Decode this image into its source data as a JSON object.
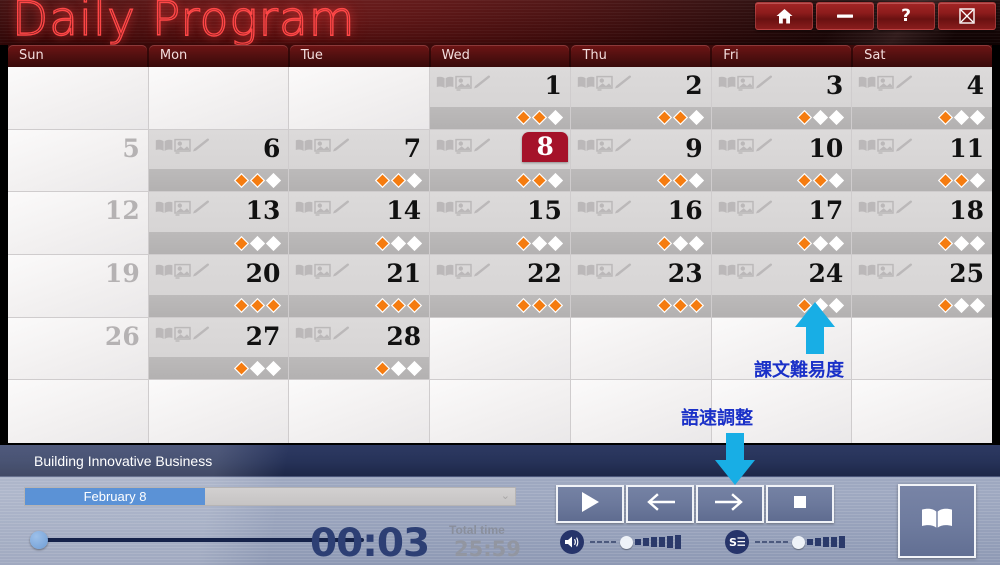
{
  "window": {
    "title": "Daily Program",
    "buttons": [
      {
        "name": "home-button",
        "icon": "home-icon",
        "label": ""
      },
      {
        "name": "minimize-button",
        "icon": "minimize-icon",
        "label": ""
      },
      {
        "name": "help-button",
        "icon": "question-icon",
        "label": "?"
      },
      {
        "name": "close-button",
        "icon": "close-boxed-icon",
        "label": ""
      }
    ]
  },
  "calendar": {
    "weekdays": [
      "Sun",
      "Mon",
      "Tue",
      "Wed",
      "Thu",
      "Fri",
      "Sat"
    ],
    "selected_day": 8,
    "cell_icons": [
      "book-icon",
      "media-card-icon",
      "pencil-icon"
    ],
    "difficulty_max": 3,
    "weeks": [
      [
        {
          "day": "",
          "state": "blank"
        },
        {
          "day": "",
          "state": "blank"
        },
        {
          "day": "",
          "state": "blank"
        },
        {
          "day": "1",
          "state": "lesson",
          "difficulty": 2
        },
        {
          "day": "2",
          "state": "lesson",
          "difficulty": 2
        },
        {
          "day": "3",
          "state": "lesson",
          "difficulty": 1
        },
        {
          "day": "4",
          "state": "lesson",
          "difficulty": 1
        }
      ],
      [
        {
          "day": "5",
          "state": "empty"
        },
        {
          "day": "6",
          "state": "lesson",
          "difficulty": 2
        },
        {
          "day": "7",
          "state": "lesson",
          "difficulty": 2
        },
        {
          "day": "8",
          "state": "lesson",
          "difficulty": 2,
          "selected": true
        },
        {
          "day": "9",
          "state": "lesson",
          "difficulty": 2
        },
        {
          "day": "10",
          "state": "lesson",
          "difficulty": 2
        },
        {
          "day": "11",
          "state": "lesson",
          "difficulty": 2
        }
      ],
      [
        {
          "day": "12",
          "state": "empty"
        },
        {
          "day": "13",
          "state": "lesson",
          "difficulty": 1
        },
        {
          "day": "14",
          "state": "lesson",
          "difficulty": 1
        },
        {
          "day": "15",
          "state": "lesson",
          "difficulty": 1
        },
        {
          "day": "16",
          "state": "lesson",
          "difficulty": 1
        },
        {
          "day": "17",
          "state": "lesson",
          "difficulty": 1
        },
        {
          "day": "18",
          "state": "lesson",
          "difficulty": 1
        }
      ],
      [
        {
          "day": "19",
          "state": "empty"
        },
        {
          "day": "20",
          "state": "lesson",
          "difficulty": 3
        },
        {
          "day": "21",
          "state": "lesson",
          "difficulty": 3
        },
        {
          "day": "22",
          "state": "lesson",
          "difficulty": 3
        },
        {
          "day": "23",
          "state": "lesson",
          "difficulty": 3
        },
        {
          "day": "24",
          "state": "lesson",
          "difficulty": 1
        },
        {
          "day": "25",
          "state": "lesson",
          "difficulty": 1
        }
      ],
      [
        {
          "day": "26",
          "state": "empty"
        },
        {
          "day": "27",
          "state": "lesson",
          "difficulty": 1
        },
        {
          "day": "28",
          "state": "lesson",
          "difficulty": 1
        },
        {
          "day": "",
          "state": "blank"
        },
        {
          "day": "",
          "state": "blank"
        },
        {
          "day": "",
          "state": "blank"
        },
        {
          "day": "",
          "state": "blank"
        }
      ],
      [
        {
          "day": "",
          "state": "blank"
        },
        {
          "day": "",
          "state": "blank"
        },
        {
          "day": "",
          "state": "blank"
        },
        {
          "day": "",
          "state": "blank"
        },
        {
          "day": "",
          "state": "blank"
        },
        {
          "day": "",
          "state": "blank"
        },
        {
          "day": "",
          "state": "blank"
        }
      ]
    ]
  },
  "player": {
    "lesson_title": "Building Innovative Business",
    "selected_lesson": "February 8",
    "current_time": "00:03",
    "total_time_label": "Total time",
    "total_time": "25:59",
    "progress_percent": 0,
    "controls": [
      {
        "name": "play-button",
        "icon": "play-icon"
      },
      {
        "name": "previous-button",
        "icon": "arrow-left-icon"
      },
      {
        "name": "next-button",
        "icon": "arrow-right-icon"
      },
      {
        "name": "stop-button",
        "icon": "stop-icon"
      }
    ],
    "volume": {
      "icon": "speaker-icon",
      "dashes": 4,
      "blocks": 6
    },
    "speed": {
      "icon": "speed-s-icon",
      "dashes": 5,
      "blocks": 5
    },
    "dictionary_button": {
      "name": "dictionary-button",
      "icon": "book-icon"
    }
  },
  "annotations": [
    {
      "text": "課文難易度",
      "name": "annotation-difficulty"
    },
    {
      "text": "語速調整",
      "name": "annotation-speed"
    }
  ],
  "colors": {
    "accent_red": "#a51229",
    "diamond_filled": "#f57c10",
    "annotation_blue": "#1a30c8",
    "arrow_cyan": "#18aee5",
    "player_blue": "#26346a"
  }
}
